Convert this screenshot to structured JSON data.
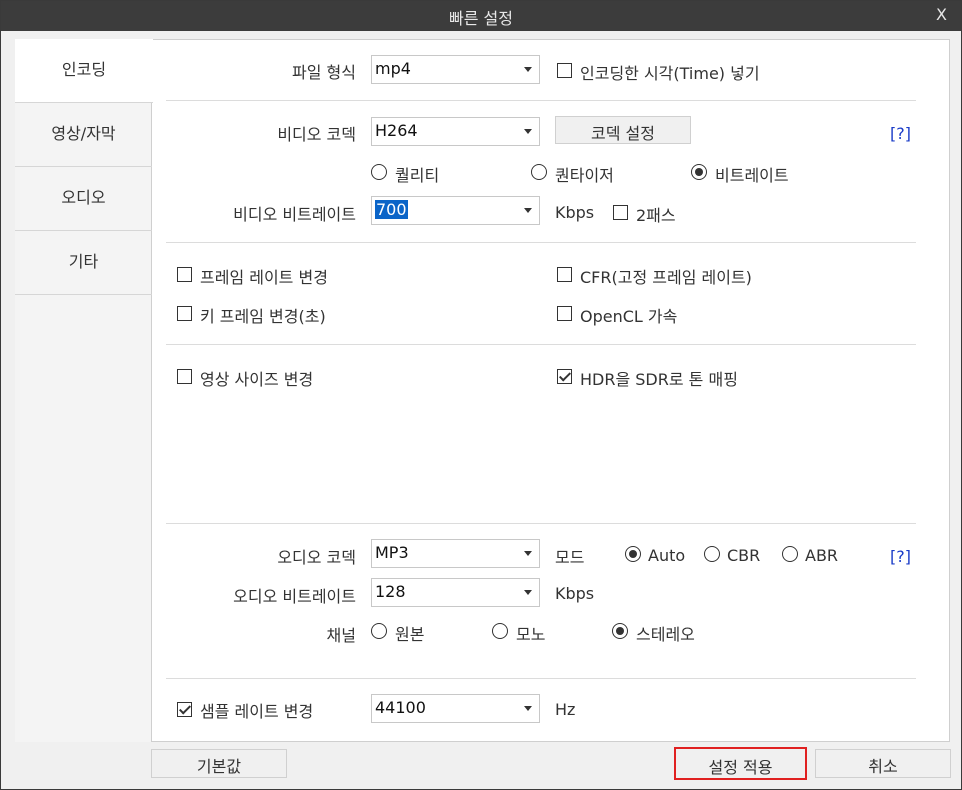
{
  "window": {
    "title": "빠른 설정",
    "close_label": "X"
  },
  "sidebar": {
    "items": [
      {
        "label": "인코딩",
        "active": true
      },
      {
        "label": "영상/자막",
        "active": false
      },
      {
        "label": "오디오",
        "active": false
      },
      {
        "label": "기타",
        "active": false
      }
    ]
  },
  "encoding": {
    "file_format_label": "파일 형식",
    "file_format_value": "mp4",
    "insert_time_label": "인코딩한 시각(Time) 넣기",
    "insert_time_checked": false
  },
  "video": {
    "codec_label": "비디오 코덱",
    "codec_value": "H264",
    "codec_settings_button": "코덱 설정",
    "help_label": "[?]",
    "mode_options": [
      "퀄리티",
      "퀀타이저",
      "비트레이트"
    ],
    "mode_selected": "비트레이트",
    "bitrate_label": "비디오 비트레이트",
    "bitrate_value": "700",
    "bitrate_unit": "Kbps",
    "two_pass_label": "2패스",
    "two_pass_checked": false
  },
  "frame": {
    "change_framerate_label": "프레임 레이트 변경",
    "change_framerate_checked": false,
    "cfr_label": "CFR(고정 프레임 레이트)",
    "cfr_checked": false,
    "keyframe_label": "키 프레임 변경(초)",
    "keyframe_checked": false,
    "opencl_label": "OpenCL 가속",
    "opencl_checked": false
  },
  "size": {
    "resize_label": "영상 사이즈 변경",
    "resize_checked": false,
    "hdr_label": "HDR을 SDR로 톤 매핑",
    "hdr_checked": true
  },
  "audio": {
    "codec_label": "오디오 코덱",
    "codec_value": "MP3",
    "mode_label": "모드",
    "mode_options": [
      "Auto",
      "CBR",
      "ABR"
    ],
    "mode_selected": "Auto",
    "help_label": "[?]",
    "bitrate_label": "오디오 비트레이트",
    "bitrate_value": "128",
    "bitrate_unit": "Kbps",
    "channel_label": "채널",
    "channel_options": [
      "원본",
      "모노",
      "스테레오"
    ],
    "channel_selected": "스테레오",
    "samplerate_label": "샘플 레이트 변경",
    "samplerate_checked": true,
    "samplerate_value": "44100",
    "samplerate_unit": "Hz"
  },
  "footer": {
    "default_button": "기본값",
    "apply_button": "설정 적용",
    "cancel_button": "취소"
  },
  "colors": {
    "highlight_border": "#e02020",
    "selection": "#0a64c8",
    "help_link": "#1a3cc8"
  }
}
